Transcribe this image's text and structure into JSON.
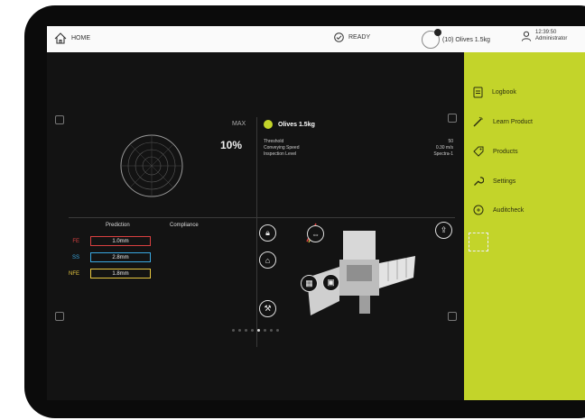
{
  "topbar": {
    "home_label": "HOME",
    "status": "READY",
    "product_label": "(10) Olives 1.5kg",
    "time": "12:39:50",
    "user": "Administrator"
  },
  "sidebar": {
    "items": [
      {
        "label": "Logbook",
        "icon": "logbook-icon"
      },
      {
        "label": "Learn Product",
        "icon": "learn-product-icon"
      },
      {
        "label": "Products",
        "icon": "products-tag-icon"
      },
      {
        "label": "Settings",
        "icon": "wrench-icon"
      },
      {
        "label": "Auditcheck",
        "icon": "auditcheck-icon"
      }
    ]
  },
  "gauge": {
    "max_label": "MAX",
    "max_value": "10%"
  },
  "product": {
    "name": "Olives 1.5kg",
    "params": [
      {
        "label": "Threshold",
        "value": "50"
      },
      {
        "label": "Conveying Speed",
        "value": "0.30 m/s"
      },
      {
        "label": "Inspection Level",
        "value": "Spectra-1"
      }
    ]
  },
  "prediction": {
    "prediction_header": "Prediction",
    "compliance_header": "Compliance",
    "rows": [
      {
        "metal": "FE",
        "value": "1.0mm",
        "color": "#d94040"
      },
      {
        "metal": "SS",
        "value": "2.8mm",
        "color": "#3aa7e0"
      },
      {
        "metal": "NFE",
        "value": "1.8mm",
        "color": "#e8c840"
      }
    ]
  },
  "pager": {
    "count": 8,
    "active": 4
  },
  "colors": {
    "accent": "#c3d42a",
    "background": "#131313"
  }
}
